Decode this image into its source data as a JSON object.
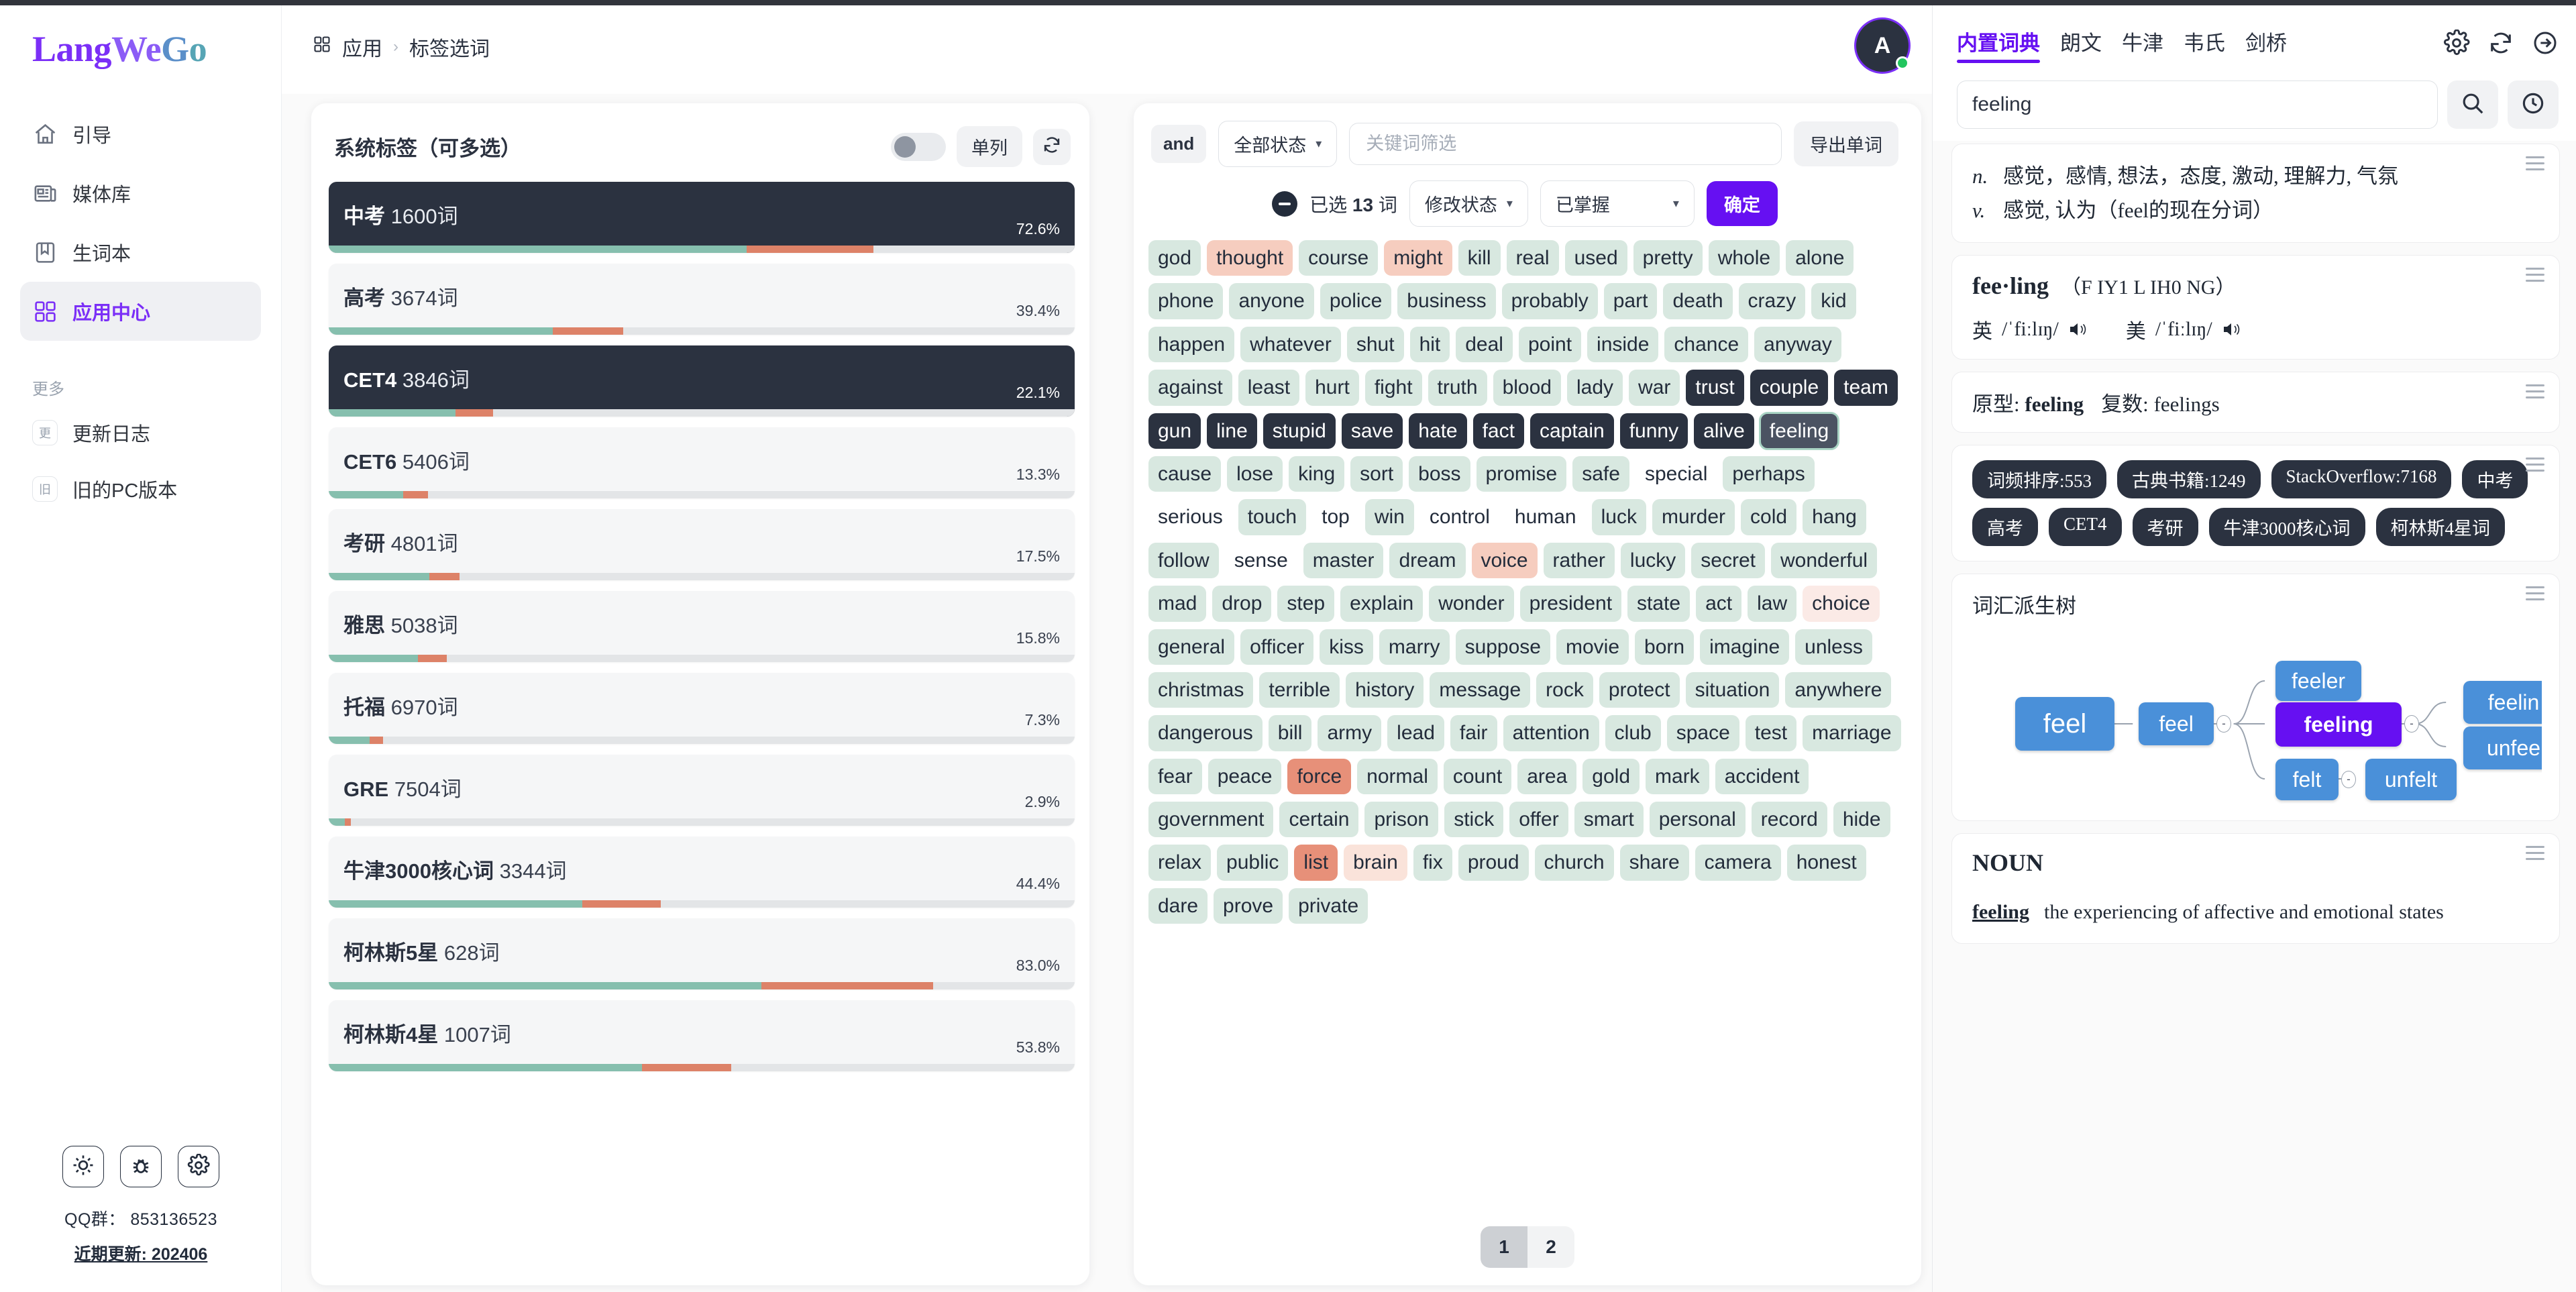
{
  "brand": {
    "part1": "Lang",
    "part2": "We",
    "part3": "G",
    "part4": "o"
  },
  "sidebar": {
    "items": [
      {
        "label": "引导",
        "icon": "home-icon"
      },
      {
        "label": "媒体库",
        "icon": "media-library-icon"
      },
      {
        "label": "生词本",
        "icon": "bookmark-icon"
      },
      {
        "label": "应用中心",
        "icon": "grid-apps-icon",
        "active": true
      }
    ],
    "more_label": "更多",
    "minor_items": [
      {
        "badge": "更",
        "label": "更新日志"
      },
      {
        "badge": "旧",
        "label": "旧的PC版本"
      }
    ],
    "bottom_buttons": [
      {
        "icon": "sun-icon",
        "name": "theme-toggle-button"
      },
      {
        "icon": "bug-icon",
        "name": "report-bug-button"
      },
      {
        "icon": "gear-icon",
        "name": "settings-button"
      }
    ],
    "qq_group": "QQ群： 853136523",
    "recent_update": "近期更新: 202406"
  },
  "header": {
    "breadcrumb_root": "应用",
    "breadcrumb_sep": "›",
    "breadcrumb_current": "标签选词",
    "avatar_initial": "A"
  },
  "tags_panel": {
    "title": "系统标签（可多选）",
    "column_mode_label": "单列",
    "refresh_icon": "refresh-icon",
    "toggle_on": false,
    "rows": [
      {
        "name": "中考",
        "count": "1600词",
        "pct": "72.6%",
        "green": 56,
        "red": 17,
        "selected": true
      },
      {
        "name": "高考",
        "count": "3674词",
        "pct": "39.4%",
        "green": 30,
        "red": 9.5,
        "selected": false
      },
      {
        "name": "CET4",
        "count": "3846词",
        "pct": "22.1%",
        "green": 17,
        "red": 5,
        "selected": true
      },
      {
        "name": "CET6",
        "count": "5406词",
        "pct": "13.3%",
        "green": 10,
        "red": 3.3,
        "selected": false
      },
      {
        "name": "考研",
        "count": "4801词",
        "pct": "17.5%",
        "green": 13.5,
        "red": 4,
        "selected": false
      },
      {
        "name": "雅思",
        "count": "5038词",
        "pct": "15.8%",
        "green": 12,
        "red": 3.8,
        "selected": false
      },
      {
        "name": "托福",
        "count": "6970词",
        "pct": "7.3%",
        "green": 5.5,
        "red": 1.8,
        "selected": false
      },
      {
        "name": "GRE",
        "count": "7504词",
        "pct": "2.9%",
        "green": 2.2,
        "red": 0.8,
        "selected": false
      },
      {
        "name": "牛津3000核心词",
        "count": "3344词",
        "pct": "44.4%",
        "green": 34,
        "red": 10.5,
        "selected": false
      },
      {
        "name": "柯林斯5星",
        "count": "628词",
        "pct": "83.0%",
        "green": 58,
        "red": 23,
        "selected": false
      },
      {
        "name": "柯林斯4星",
        "count": "1007词",
        "pct": "53.8%",
        "green": 42,
        "red": 12,
        "selected": false
      }
    ]
  },
  "words_panel": {
    "and_label": "and",
    "status_filter": "全部状态",
    "keyword_placeholder": "关键词筛选",
    "keyword_value": "",
    "export_label": "导出单词",
    "selected_text_prefix": "已选 ",
    "selected_count": "13",
    "selected_text_suffix": " 词",
    "modify_status_label": "修改状态",
    "mastered_label": "已掌握",
    "confirm_label": "确定",
    "collapse_handle": "»",
    "pagination": {
      "pages": [
        "1",
        "2"
      ],
      "active": "1"
    },
    "chips": [
      {
        "w": "god",
        "s": "green"
      },
      {
        "w": "thought",
        "s": "pink"
      },
      {
        "w": "course",
        "s": "green"
      },
      {
        "w": "might",
        "s": "pink"
      },
      {
        "w": "kill",
        "s": "green"
      },
      {
        "w": "real",
        "s": "green"
      },
      {
        "w": "used",
        "s": "green"
      },
      {
        "w": "pretty",
        "s": "green"
      },
      {
        "w": "whole",
        "s": "green"
      },
      {
        "w": "alone",
        "s": "green"
      },
      {
        "w": "phone",
        "s": "green"
      },
      {
        "w": "anyone",
        "s": "green"
      },
      {
        "w": "police",
        "s": "green"
      },
      {
        "w": "business",
        "s": "green"
      },
      {
        "w": "probably",
        "s": "green"
      },
      {
        "w": "part",
        "s": "green"
      },
      {
        "w": "death",
        "s": "green"
      },
      {
        "w": "crazy",
        "s": "green"
      },
      {
        "w": "kid",
        "s": "green"
      },
      {
        "w": "happen",
        "s": "green"
      },
      {
        "w": "whatever",
        "s": "green"
      },
      {
        "w": "shut",
        "s": "green"
      },
      {
        "w": "hit",
        "s": "green"
      },
      {
        "w": "deal",
        "s": "green"
      },
      {
        "w": "point",
        "s": "green"
      },
      {
        "w": "inside",
        "s": "green"
      },
      {
        "w": "chance",
        "s": "green"
      },
      {
        "w": "anyway",
        "s": "green"
      },
      {
        "w": "against",
        "s": "green"
      },
      {
        "w": "least",
        "s": "green"
      },
      {
        "w": "hurt",
        "s": "green"
      },
      {
        "w": "fight",
        "s": "green"
      },
      {
        "w": "truth",
        "s": "green"
      },
      {
        "w": "blood",
        "s": "green"
      },
      {
        "w": "lady",
        "s": "green"
      },
      {
        "w": "war",
        "s": "green"
      },
      {
        "w": "trust",
        "s": "dark"
      },
      {
        "w": "couple",
        "s": "dark"
      },
      {
        "w": "team",
        "s": "dark"
      },
      {
        "w": "gun",
        "s": "dark"
      },
      {
        "w": "line",
        "s": "dark"
      },
      {
        "w": "stupid",
        "s": "dark"
      },
      {
        "w": "save",
        "s": "dark"
      },
      {
        "w": "hate",
        "s": "dark"
      },
      {
        "w": "fact",
        "s": "dark"
      },
      {
        "w": "captain",
        "s": "dark"
      },
      {
        "w": "funny",
        "s": "dark"
      },
      {
        "w": "alive",
        "s": "dark"
      },
      {
        "w": "feeling",
        "s": "current"
      },
      {
        "w": "cause",
        "s": "green"
      },
      {
        "w": "lose",
        "s": "green"
      },
      {
        "w": "king",
        "s": "green"
      },
      {
        "w": "sort",
        "s": "green"
      },
      {
        "w": "boss",
        "s": "green"
      },
      {
        "w": "promise",
        "s": "green"
      },
      {
        "w": "safe",
        "s": "green"
      },
      {
        "w": "special",
        "s": "none"
      },
      {
        "w": "perhaps",
        "s": "green"
      },
      {
        "w": "serious",
        "s": "none"
      },
      {
        "w": "touch",
        "s": "green"
      },
      {
        "w": "top",
        "s": "none"
      },
      {
        "w": "win",
        "s": "green"
      },
      {
        "w": "control",
        "s": "none"
      },
      {
        "w": "human",
        "s": "none"
      },
      {
        "w": "luck",
        "s": "green"
      },
      {
        "w": "murder",
        "s": "green"
      },
      {
        "w": "cold",
        "s": "green"
      },
      {
        "w": "hang",
        "s": "green"
      },
      {
        "w": "follow",
        "s": "green"
      },
      {
        "w": "sense",
        "s": "none"
      },
      {
        "w": "master",
        "s": "green"
      },
      {
        "w": "dream",
        "s": "green"
      },
      {
        "w": "voice",
        "s": "pink"
      },
      {
        "w": "rather",
        "s": "green"
      },
      {
        "w": "lucky",
        "s": "green"
      },
      {
        "w": "secret",
        "s": "green"
      },
      {
        "w": "wonderful",
        "s": "green"
      },
      {
        "w": "mad",
        "s": "green"
      },
      {
        "w": "drop",
        "s": "green"
      },
      {
        "w": "step",
        "s": "green"
      },
      {
        "w": "explain",
        "s": "green"
      },
      {
        "w": "wonder",
        "s": "green"
      },
      {
        "w": "president",
        "s": "green"
      },
      {
        "w": "state",
        "s": "green"
      },
      {
        "w": "act",
        "s": "green"
      },
      {
        "w": "law",
        "s": "green"
      },
      {
        "w": "choice",
        "s": "faint"
      },
      {
        "w": "general",
        "s": "green"
      },
      {
        "w": "officer",
        "s": "green"
      },
      {
        "w": "kiss",
        "s": "green"
      },
      {
        "w": "marry",
        "s": "green"
      },
      {
        "w": "suppose",
        "s": "green"
      },
      {
        "w": "movie",
        "s": "green"
      },
      {
        "w": "born",
        "s": "green"
      },
      {
        "w": "imagine",
        "s": "green"
      },
      {
        "w": "unless",
        "s": "green"
      },
      {
        "w": "christmas",
        "s": "green"
      },
      {
        "w": "terrible",
        "s": "green"
      },
      {
        "w": "history",
        "s": "green"
      },
      {
        "w": "message",
        "s": "green"
      },
      {
        "w": "rock",
        "s": "green"
      },
      {
        "w": "protect",
        "s": "green"
      },
      {
        "w": "situation",
        "s": "green"
      },
      {
        "w": "anywhere",
        "s": "green"
      },
      {
        "w": "dangerous",
        "s": "green"
      },
      {
        "w": "bill",
        "s": "green"
      },
      {
        "w": "army",
        "s": "green"
      },
      {
        "w": "lead",
        "s": "green"
      },
      {
        "w": "fair",
        "s": "green"
      },
      {
        "w": "attention",
        "s": "green"
      },
      {
        "w": "club",
        "s": "green"
      },
      {
        "w": "space",
        "s": "green"
      },
      {
        "w": "test",
        "s": "green"
      },
      {
        "w": "marriage",
        "s": "green"
      },
      {
        "w": "fear",
        "s": "green"
      },
      {
        "w": "peace",
        "s": "green"
      },
      {
        "w": "force",
        "s": "red"
      },
      {
        "w": "normal",
        "s": "green"
      },
      {
        "w": "count",
        "s": "green"
      },
      {
        "w": "area",
        "s": "green"
      },
      {
        "w": "gold",
        "s": "green"
      },
      {
        "w": "mark",
        "s": "green"
      },
      {
        "w": "accident",
        "s": "green"
      },
      {
        "w": "government",
        "s": "green"
      },
      {
        "w": "certain",
        "s": "green"
      },
      {
        "w": "prison",
        "s": "green"
      },
      {
        "w": "stick",
        "s": "green"
      },
      {
        "w": "offer",
        "s": "green"
      },
      {
        "w": "smart",
        "s": "green"
      },
      {
        "w": "personal",
        "s": "green"
      },
      {
        "w": "record",
        "s": "green"
      },
      {
        "w": "hide",
        "s": "green"
      },
      {
        "w": "relax",
        "s": "green"
      },
      {
        "w": "public",
        "s": "green"
      },
      {
        "w": "list",
        "s": "red"
      },
      {
        "w": "brain",
        "s": "pink2"
      },
      {
        "w": "fix",
        "s": "green"
      },
      {
        "w": "proud",
        "s": "green"
      },
      {
        "w": "church",
        "s": "green"
      },
      {
        "w": "share",
        "s": "green"
      },
      {
        "w": "camera",
        "s": "green"
      },
      {
        "w": "honest",
        "s": "green"
      },
      {
        "w": "dare",
        "s": "green"
      },
      {
        "w": "prove",
        "s": "green"
      },
      {
        "w": "private",
        "s": "green"
      }
    ]
  },
  "dictionary": {
    "tabs": [
      {
        "label": "内置词典",
        "active": true
      },
      {
        "label": "朗文",
        "active": false
      },
      {
        "label": "牛津",
        "active": false
      },
      {
        "label": "韦氏",
        "active": false
      },
      {
        "label": "剑桥",
        "active": false
      }
    ],
    "tab_icons": [
      "gear-icon",
      "refresh-icon",
      "arrow-right-circle-icon"
    ],
    "search_value": "feeling",
    "search_placeholder": "",
    "search_icon": "search-icon",
    "history_icon": "clock-history-icon",
    "senses": [
      {
        "pos": "n.",
        "text": "感觉，感情, 想法，态度, 激动, 理解力, 气氛"
      },
      {
        "pos": "v.",
        "text": "感觉, 认为（feel的现在分词）"
      }
    ],
    "headword": "fee·ling",
    "headword_phonetic": "（F IY1 L IH0 NG）",
    "phonetics": [
      {
        "region": "英",
        "ipa": "/ˈfiːlɪŋ/"
      },
      {
        "region": "美",
        "ipa": "/ˈfiːlɪŋ/"
      }
    ],
    "morphology": {
      "base_label": "原型:",
      "base": "feeling",
      "plural_label": "复数:",
      "plural": "feelings"
    },
    "badges": [
      "词频排序:553",
      "古典书籍:1249",
      "StackOverflow:7168",
      "中考",
      "高考",
      "CET4",
      "考研",
      "牛津3000核心词",
      "柯林斯4星词"
    ],
    "tree": {
      "title": "词汇派生树",
      "nodes": [
        {
          "label": "feel",
          "kind": "lg"
        },
        {
          "label": "feel",
          "kind": "md"
        },
        {
          "label": "feeler",
          "kind": "md"
        },
        {
          "label": "feeling",
          "kind": "root"
        },
        {
          "label": "feelin",
          "kind": "md"
        },
        {
          "label": "unfee",
          "kind": "md"
        },
        {
          "label": "felt",
          "kind": "md"
        },
        {
          "label": "unfelt",
          "kind": "md"
        }
      ],
      "collapse_markers": [
        "-",
        "-",
        "-"
      ]
    },
    "pos_section": {
      "heading": "NOUN",
      "entry_word": "feeling",
      "definition": "the experiencing of affective and emotional states"
    }
  }
}
